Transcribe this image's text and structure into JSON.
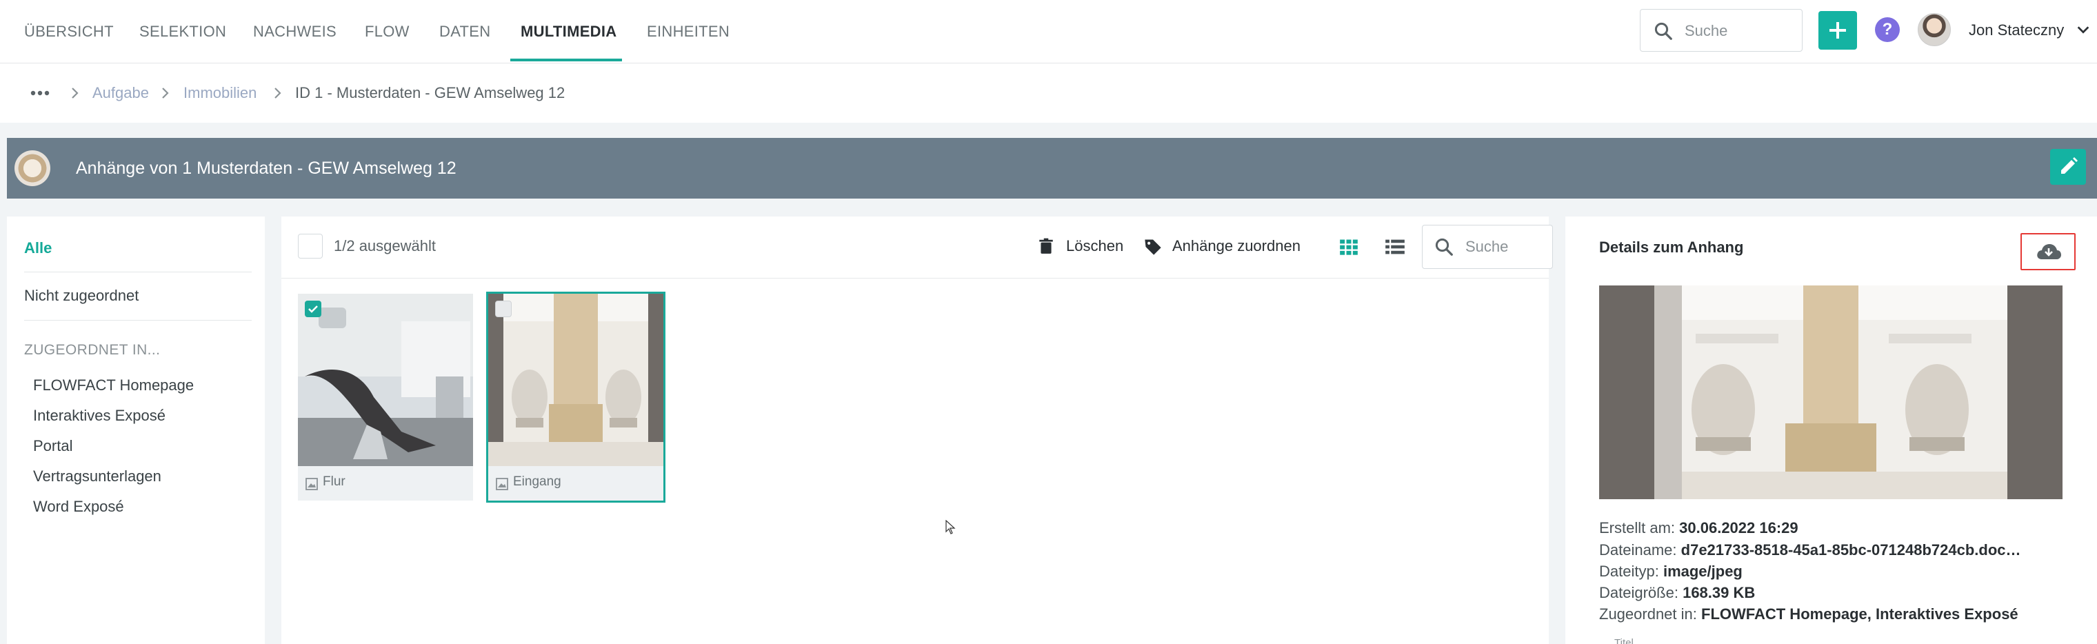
{
  "nav": {
    "tabs": [
      {
        "label": "ÜBERSICHT"
      },
      {
        "label": "SELEKTION"
      },
      {
        "label": "NACHWEIS"
      },
      {
        "label": "FLOW"
      },
      {
        "label": "DATEN"
      },
      {
        "label": "MULTIMEDIA"
      },
      {
        "label": "EINHEITEN"
      }
    ],
    "active_tab": "MULTIMEDIA",
    "search_placeholder": "Suche",
    "user_name": "Jon Statecz­ny",
    "accent_color": "#14b3a2"
  },
  "breadcrumb": {
    "items": [
      "Aufgabe",
      "Immobilien",
      "ID 1 - Musterdaten - GEW Amselweg 12"
    ]
  },
  "header": {
    "title": "Anhänge von 1 Musterdaten - GEW Amselweg 12"
  },
  "sidebar": {
    "all": "Alle",
    "unassigned": "Nicht zugeordnet",
    "assigned_heading": "ZUGEORDNET IN...",
    "targets": [
      "FLOWFACT Homepage",
      "Interaktives Exposé",
      "Portal",
      "Vertragsunterlagen",
      "Word Exposé"
    ]
  },
  "toolbar": {
    "selection_count": "1/2 ausgewählt",
    "delete_label": "Löschen",
    "assign_label": "Anhänge zuordnen",
    "search_placeholder": "Suche"
  },
  "attachments": [
    {
      "name": "Flur",
      "checked": true,
      "file_icon": "image-icon"
    },
    {
      "name": "Eingang",
      "checked": false,
      "file_icon": "image-icon"
    }
  ],
  "details": {
    "title": "Details zum Anhang",
    "created_label": "Erstellt am:",
    "created_value": "30.06.2022 16:29",
    "filename_label": "Dateiname:",
    "filename_value": "d7e21733-8518-45a1-85bc-071248b724cb.doc…",
    "filetype_label": "Dateityp:",
    "filetype_value": "image/jpeg",
    "filesize_label": "Dateigröße:",
    "filesize_value": "168.39 KB",
    "assigned_label": "Zugeordnet in:",
    "assigned_value": "FLOWFACT Homepage, Interaktives Exposé",
    "title_field_hint": "Titel"
  }
}
